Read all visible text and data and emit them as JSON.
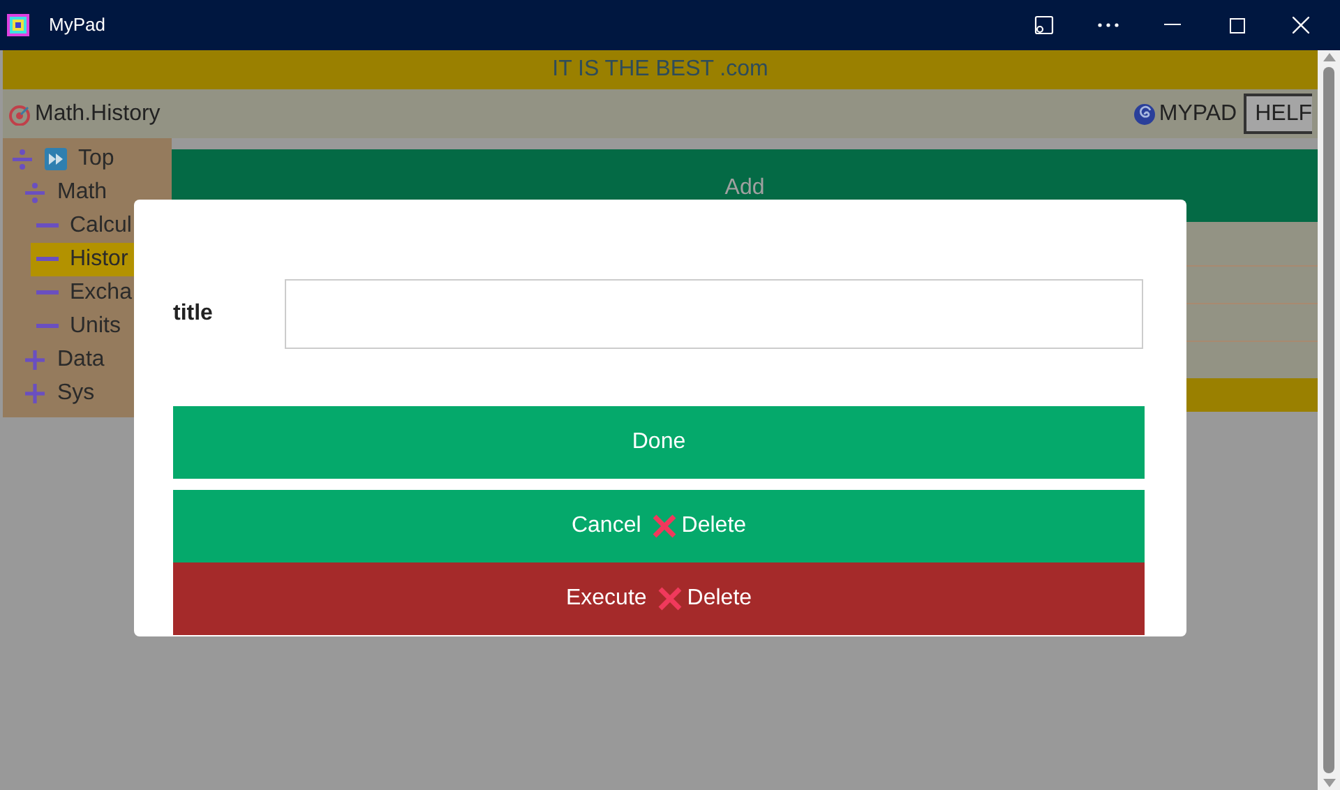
{
  "window": {
    "title": "MyPad"
  },
  "banner": {
    "text": "IT IS THE BEST .com"
  },
  "toolbar": {
    "breadcrumb": "Math.History",
    "brand": "MYPAD",
    "help_button": "HELF"
  },
  "sidebar": {
    "items": [
      {
        "label": "Top",
        "kind": "folder",
        "expanded": true,
        "selected": false,
        "children": [
          {
            "label": "Math",
            "kind": "folder",
            "expanded": true,
            "selected": false,
            "children": [
              {
                "label": "Calcul",
                "kind": "leaf",
                "selected": false
              },
              {
                "label": "Histor",
                "kind": "leaf",
                "selected": true
              },
              {
                "label": "Excha",
                "kind": "leaf",
                "selected": false
              },
              {
                "label": "Units",
                "kind": "leaf",
                "selected": false
              }
            ]
          },
          {
            "label": "Data",
            "kind": "folder",
            "expanded": false,
            "selected": false
          },
          {
            "label": "Sys",
            "kind": "folder",
            "expanded": false,
            "selected": false
          }
        ]
      }
    ]
  },
  "main": {
    "add_button": "Add"
  },
  "dialog": {
    "field": {
      "label": "title"
    },
    "buttons": [
      {
        "label": "Done",
        "kind": "confirm"
      },
      {
        "label": "Cancel",
        "suffix": "Delete",
        "kind": "cancel"
      },
      {
        "label": "Execute",
        "suffix": "Delete",
        "kind": "danger"
      }
    ]
  }
}
